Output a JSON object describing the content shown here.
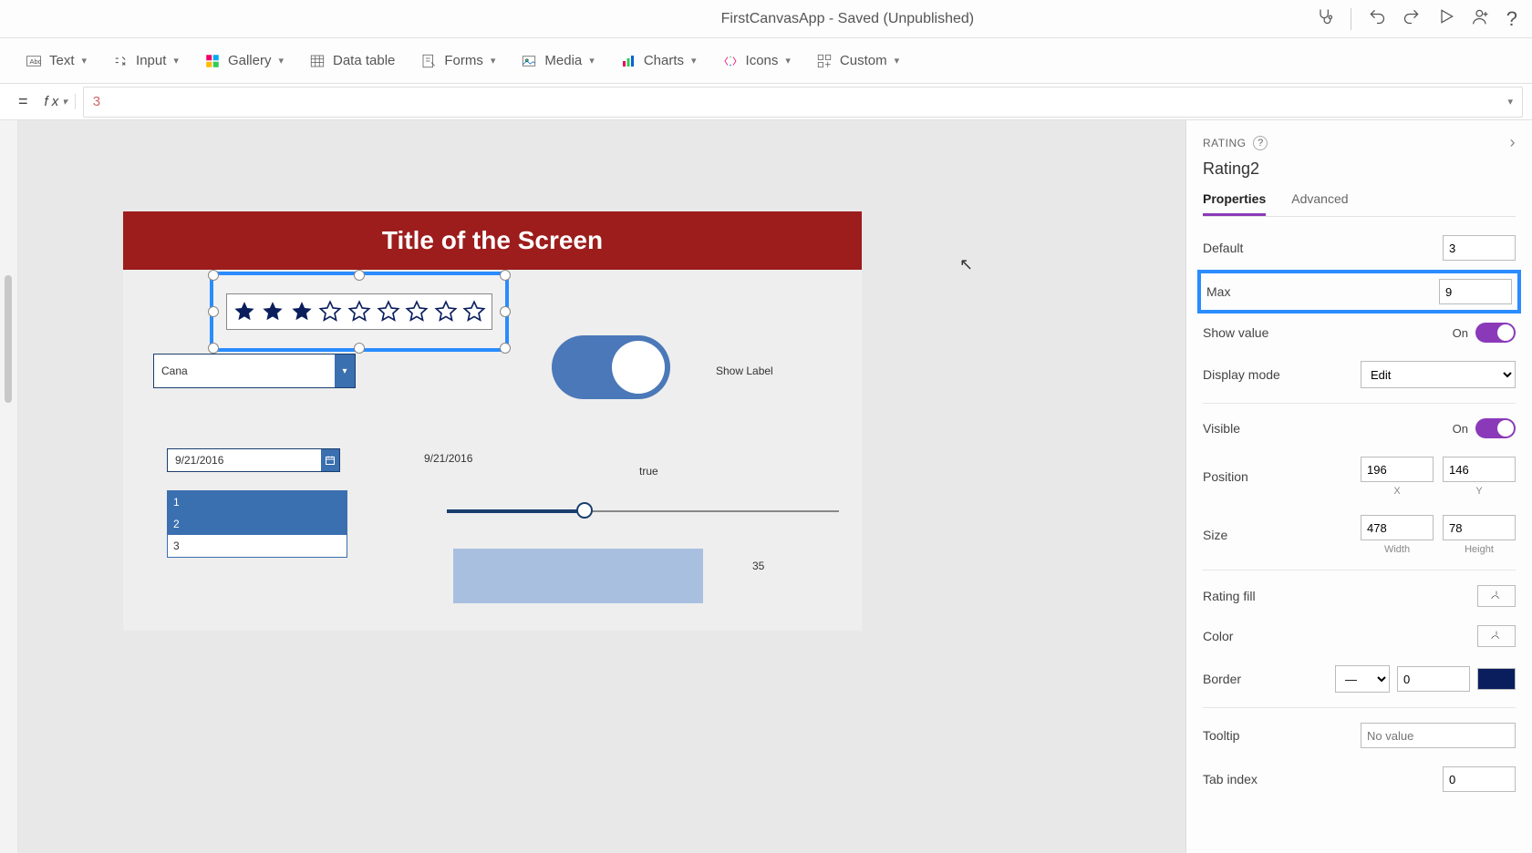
{
  "app_title": "FirstCanvasApp - Saved (Unpublished)",
  "ribbon": {
    "text": "Text",
    "input": "Input",
    "gallery": "Gallery",
    "datatable": "Data table",
    "forms": "Forms",
    "media": "Media",
    "charts": "Charts",
    "icons": "Icons",
    "custom": "Custom"
  },
  "formula": {
    "value": "3"
  },
  "canvas": {
    "screen_title": "Title of the Screen",
    "rating": {
      "filled": 3,
      "total": 9
    },
    "dropdown_value": "Cana",
    "toggle_label": "Show Label",
    "date_value": "9/21/2016",
    "date_text": "9/21/2016",
    "listbox": [
      "1",
      "2",
      "3"
    ],
    "slider_text": "true",
    "slider_value": "35"
  },
  "props": {
    "header": "RATING",
    "control_name": "Rating2",
    "tabs": {
      "properties": "Properties",
      "advanced": "Advanced"
    },
    "default": {
      "label": "Default",
      "value": "3"
    },
    "max": {
      "label": "Max",
      "value": "9"
    },
    "show_value": {
      "label": "Show value",
      "text": "On"
    },
    "display_mode": {
      "label": "Display mode",
      "value": "Edit"
    },
    "visible": {
      "label": "Visible",
      "text": "On"
    },
    "position": {
      "label": "Position",
      "x": "196",
      "y": "146",
      "xl": "X",
      "yl": "Y"
    },
    "size": {
      "label": "Size",
      "w": "478",
      "h": "78",
      "wl": "Width",
      "hl": "Height"
    },
    "rating_fill": {
      "label": "Rating fill"
    },
    "color": {
      "label": "Color"
    },
    "border": {
      "label": "Border",
      "width": "0"
    },
    "tooltip": {
      "label": "Tooltip",
      "placeholder": "No value"
    },
    "tabindex": {
      "label": "Tab index",
      "value": "0"
    }
  }
}
